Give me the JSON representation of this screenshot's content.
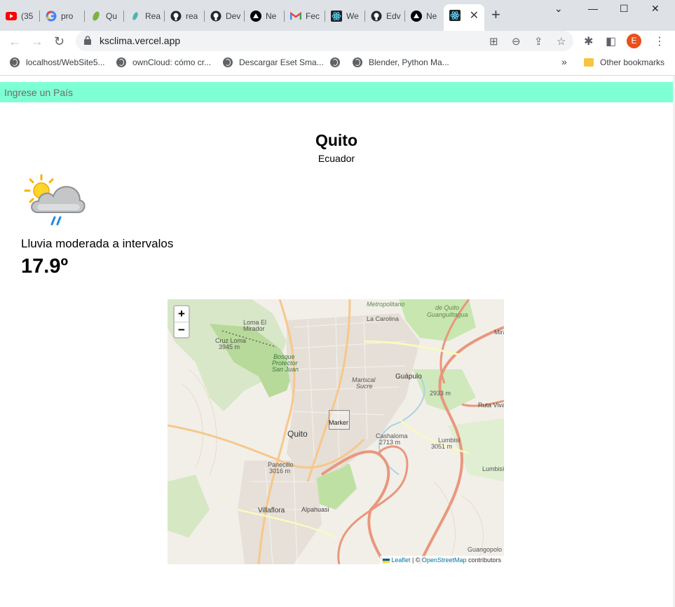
{
  "browser": {
    "tabs": [
      {
        "title": "(35",
        "icon": "youtube-icon"
      },
      {
        "title": "pro",
        "icon": "google-icon"
      },
      {
        "title": "Qu",
        "icon": "leaf-icon"
      },
      {
        "title": "Rea",
        "icon": "leaf-icon"
      },
      {
        "title": "rea",
        "icon": "github-icon"
      },
      {
        "title": "Dev",
        "icon": "github-icon"
      },
      {
        "title": "Ne",
        "icon": "vercel-icon"
      },
      {
        "title": "Fec",
        "icon": "gmail-icon"
      },
      {
        "title": "We",
        "icon": "react-icon"
      },
      {
        "title": "Edv",
        "icon": "github-icon"
      },
      {
        "title": "Ne",
        "icon": "vercel-icon"
      },
      {
        "title": "",
        "icon": "react-icon"
      }
    ],
    "new_tab": "+",
    "window_controls": {
      "minimize": "⌄",
      "restore": "—",
      "maximize": "☐",
      "close": "✕"
    },
    "url": "ksclima.vercel.app",
    "profile_initial": "E",
    "bookmarks": [
      {
        "label": "localhost/WebSite5..."
      },
      {
        "label": "ownCloud: cómo cr..."
      },
      {
        "label": "Descargar Eset Sma..."
      },
      {
        "label": ""
      },
      {
        "label": "Blender, Python Ma..."
      }
    ],
    "bookmarks_overflow": "»",
    "other_bookmarks": "Other bookmarks"
  },
  "page": {
    "search": {
      "placeholder": "Ingrese un País",
      "color": "#7fffd4"
    },
    "city": "Quito",
    "country": "Ecuador",
    "condition": "Lluvia moderada a intervalos",
    "temperature": "17.9º",
    "map": {
      "zoom_in": "+",
      "zoom_out": "−",
      "marker_label": "Marker",
      "attribution_leaflet": "Leaflet",
      "attribution_sep": " | © ",
      "attribution_osm": "OpenStreetMap",
      "attribution_tail": " contributors",
      "labels": {
        "quito": "Quito",
        "la_carolina": "La Carolina",
        "guapulo": "Guápulo",
        "villaflora": "Villaflora",
        "mariscal": "Mariscal",
        "sucre": "Sucre",
        "metropolitano": "Metropolitano",
        "de_quito": "de Quito",
        "guanguiltagua": "Guanguiltagua",
        "loma_el": "Loma El",
        "mirador": "Mirador",
        "cruz_loma": "Cruz Loma",
        "cruz_loma_alt": "3945 m",
        "bosque": "Bosque",
        "protector": "Protector",
        "san_juan": "San Juan",
        "cashaloma": "Cashaloma",
        "cashaloma_alt": "2713 m",
        "lumbisi": "Lumbisí",
        "lumbisi_alt": "3051 m",
        "lumbisi2": "Lumbisí",
        "panecillo": "Panecillo",
        "panecillo_alt": "3016 m",
        "guangopolo": "Guangopolo",
        "mira": "Mira",
        "alt_2933": "2933 m",
        "ruta_viva": "Ruta Viva",
        "alpahuasi": "Alpahuasi"
      }
    }
  }
}
